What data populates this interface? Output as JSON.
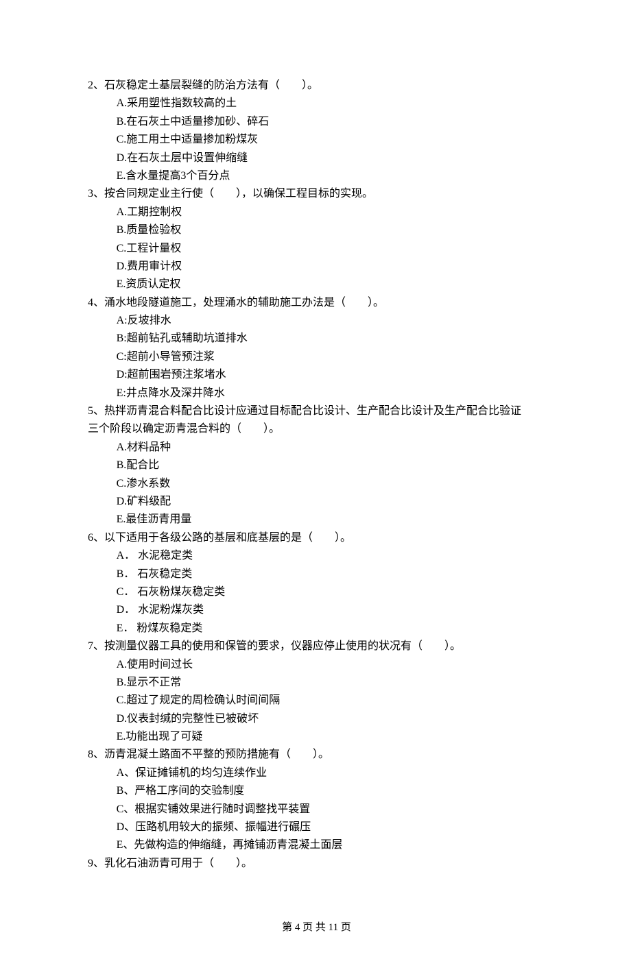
{
  "questions": [
    {
      "number": "2、",
      "stem": "石灰稳定土基层裂缝的防治方法有（　　）。",
      "options": [
        "A.采用塑性指数较高的土",
        "B.在石灰土中适量掺加砂、碎石",
        "C.施工用土中适量掺加粉煤灰",
        "D.在石灰土层中设置伸缩缝",
        "E.含水量提高3个百分点"
      ]
    },
    {
      "number": "3、",
      "stem": "按合同规定业主行使（　　），以确保工程目标的实现。",
      "options": [
        "A.工期控制权",
        "B.质量检验权",
        "C.工程计量权",
        "D.费用审计权",
        "E.资质认定权"
      ]
    },
    {
      "number": "4、",
      "stem": "涌水地段隧道施工，处理涌水的辅助施工办法是（　　）。",
      "options": [
        "A:反坡排水",
        "B:超前钻孔或辅助坑道排水",
        "C:超前小导管预注浆",
        "D:超前围岩预注浆堵水",
        "E:井点降水及深井降水"
      ]
    },
    {
      "number": "5、",
      "stem": "热拌沥青混合料配合比设计应通过目标配合比设计、生产配合比设计及生产配合比验证",
      "stem_cont": "三个阶段以确定沥青混合料的（　　）。",
      "options": [
        "A.材料品种",
        "B.配合比",
        "C.渗水系数",
        "D.矿料级配",
        "E.最佳沥青用量"
      ]
    },
    {
      "number": "6、",
      "stem": "以下适用于各级公路的基层和底基层的是（　　）。",
      "options": [
        "A． 水泥稳定类",
        "B． 石灰稳定类",
        "C． 石灰粉煤灰稳定类",
        "D． 水泥粉煤灰类",
        "E． 粉煤灰稳定类"
      ]
    },
    {
      "number": "7、",
      "stem": "按测量仪器工具的使用和保管的要求，仪器应停止使用的状况有（　　）。",
      "options": [
        "A.使用时间过长",
        "B.显示不正常",
        "C.超过了规定的周检确认时间间隔",
        "D.仪表封缄的完整性已被破坏",
        "E.功能出现了可疑"
      ]
    },
    {
      "number": "8、",
      "stem": "沥青混凝土路面不平整的预防措施有（　　）。",
      "options": [
        "A、保证摊铺机的均匀连续作业",
        "B、严格工序间的交验制度",
        "C、根据实铺效果进行随时调整找平装置",
        "D、压路机用较大的振频、振幅进行碾压",
        "E、先做构造的伸缩缝，再摊铺沥青混凝土面层"
      ]
    },
    {
      "number": "9、",
      "stem": "乳化石油沥青可用于（　　）。",
      "options": []
    }
  ],
  "footer": "第 4 页 共 11 页"
}
